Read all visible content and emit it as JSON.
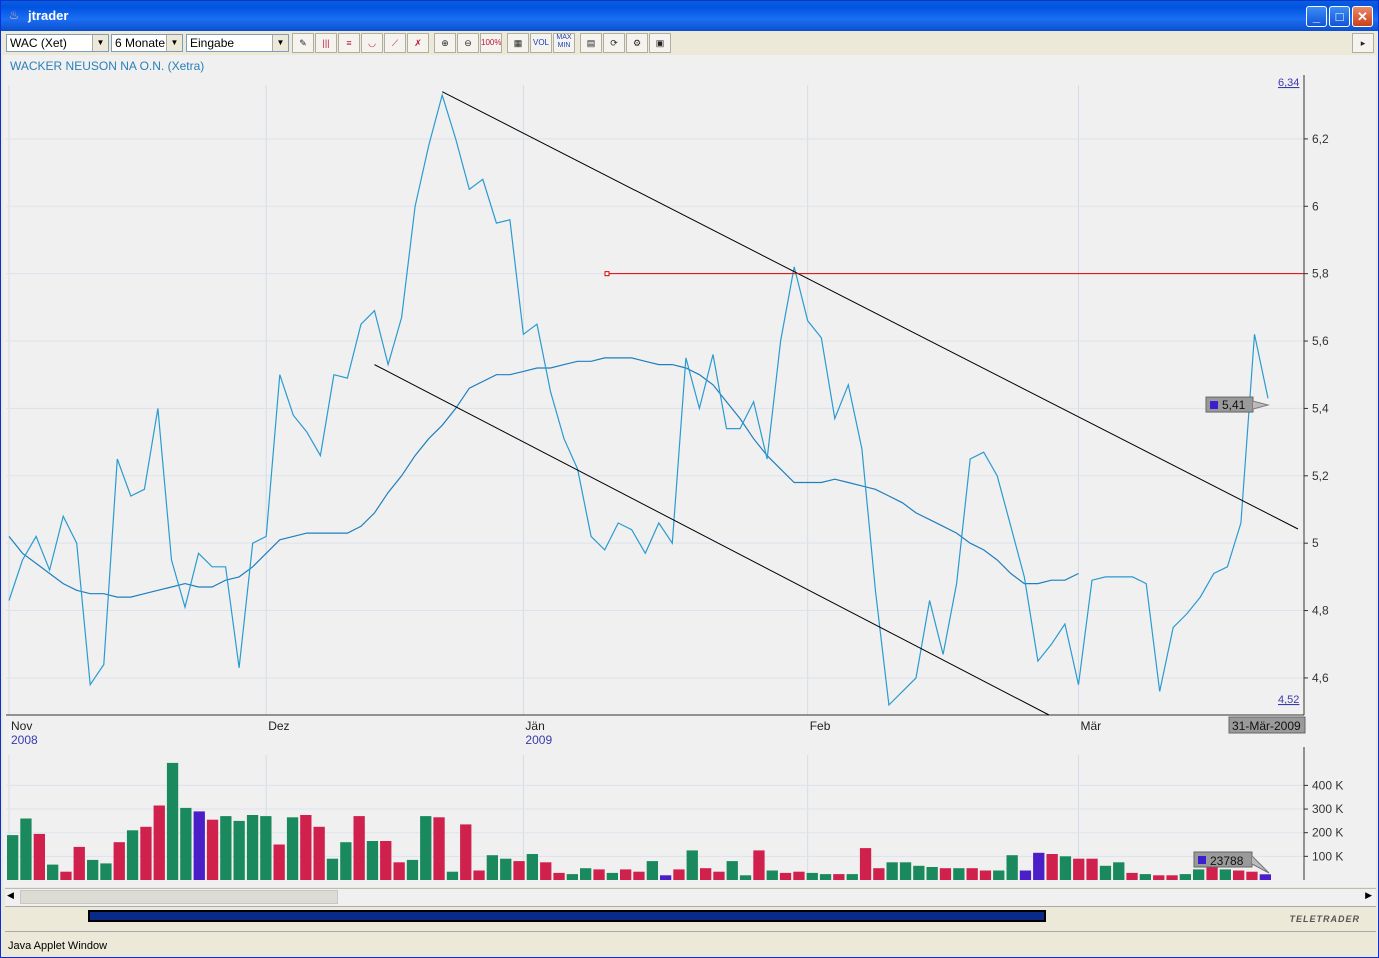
{
  "window": {
    "title": "jtrader",
    "min": "_",
    "max": "□",
    "close": "✕"
  },
  "toolbar": {
    "symbol": "WAC (Xet)",
    "period": "6 Monate",
    "mode": "Eingabe",
    "btn_vol": "VOL",
    "btn_maxmin": "MAX MIN",
    "btn_zoom100": "100%"
  },
  "stock_title": "WACKER NEUSON NA O.N. (Xetra)",
  "chart_data": [
    {
      "type": "line",
      "title": "WACKER NEUSON NA O.N. (Xetra)",
      "x_labels": [
        {
          "label": "Nov",
          "year": "2008",
          "index": 0
        },
        {
          "label": "Dez",
          "year": "",
          "index": 19
        },
        {
          "label": "Jän",
          "year": "2009",
          "index": 38
        },
        {
          "label": "Feb",
          "year": "",
          "index": 59
        },
        {
          "label": "Mär",
          "year": "",
          "index": 79
        }
      ],
      "date_marker": "31-Mär-2009",
      "yticks": [
        4.6,
        4.8,
        5,
        5.2,
        5.4,
        5.6,
        5.8,
        6,
        6.2
      ],
      "ytick_labels": [
        "4,6",
        "4,8",
        "5",
        "5,2",
        "5,4",
        "5,6",
        "5,8",
        "6",
        "6,2"
      ],
      "max_label": "6,34",
      "min_label": "4,52",
      "last_value_label": "5,41",
      "ylim": [
        4.49,
        6.36
      ],
      "series": [
        {
          "values": [
            4.83,
            4.95,
            5.02,
            4.92,
            5.08,
            5.0,
            4.58,
            4.64,
            5.25,
            5.14,
            5.16,
            5.4,
            4.95,
            4.81,
            4.97,
            4.93,
            4.93,
            4.63,
            5.0,
            5.02,
            5.5,
            5.38,
            5.33,
            5.26,
            5.5,
            5.49,
            5.65,
            5.69,
            5.53,
            5.67,
            6.0,
            6.18,
            6.33,
            6.2,
            6.05,
            6.08,
            5.95,
            5.96,
            5.62,
            5.65,
            5.45,
            5.31,
            5.22,
            5.02,
            4.98,
            5.06,
            5.04,
            4.97,
            5.06,
            5.0,
            5.55,
            5.4,
            5.56,
            5.34,
            5.34,
            5.42,
            5.25,
            5.6,
            5.82,
            5.66,
            5.61,
            5.37,
            5.47,
            5.28,
            4.86,
            4.52,
            4.56,
            4.6,
            4.83,
            4.67,
            4.88,
            5.25,
            5.27,
            5.2,
            5.05,
            4.9,
            4.65,
            4.7,
            4.76,
            4.58,
            4.89,
            4.9,
            4.9,
            4.9,
            4.88,
            4.56,
            4.75,
            4.79,
            4.84,
            4.91,
            4.93,
            5.06,
            5.62,
            5.43
          ]
        },
        {
          "values": [
            5.02,
            4.97,
            4.94,
            4.91,
            4.88,
            4.86,
            4.85,
            4.85,
            4.84,
            4.84,
            4.85,
            4.86,
            4.87,
            4.88,
            4.87,
            4.87,
            4.89,
            4.9,
            4.93,
            4.97,
            5.01,
            5.02,
            5.03,
            5.03,
            5.03,
            5.03,
            5.05,
            5.09,
            5.15,
            5.2,
            5.26,
            5.31,
            5.35,
            5.4,
            5.46,
            5.48,
            5.5,
            5.5,
            5.51,
            5.52,
            5.52,
            5.53,
            5.54,
            5.54,
            5.55,
            5.55,
            5.55,
            5.54,
            5.53,
            5.53,
            5.52,
            5.5,
            5.47,
            5.42,
            5.37,
            5.31,
            5.26,
            5.22,
            5.18,
            5.18,
            5.18,
            5.19,
            5.18,
            5.17,
            5.16,
            5.14,
            5.12,
            5.09,
            5.07,
            5.05,
            5.03,
            5.0,
            4.98,
            4.95,
            4.91,
            4.88,
            4.88,
            4.89,
            4.89,
            4.91
          ]
        }
      ],
      "annotations": {
        "horizontal_line_value": 5.8,
        "horizontal_line_color": "#e00000",
        "trend_color": "#000000"
      }
    },
    {
      "type": "bar",
      "yticks": [
        100000,
        200000,
        300000,
        400000
      ],
      "ytick_labels": [
        "100 K",
        "200 K",
        "300 K",
        "400 K"
      ],
      "ylim": [
        0,
        520000
      ],
      "last_value_label": "23788",
      "colors": {
        "up": "#1a8a5e",
        "down": "#d0204c",
        "neutral": "#4a1fc8"
      },
      "values": [
        190000,
        260000,
        195000,
        65000,
        35000,
        140000,
        85000,
        70000,
        160000,
        210000,
        225000,
        315000,
        495000,
        305000,
        290000,
        255000,
        270000,
        250000,
        275000,
        270000,
        150000,
        265000,
        275000,
        225000,
        90000,
        160000,
        270000,
        165000,
        165000,
        75000,
        85000,
        270000,
        265000,
        35000,
        235000,
        40000,
        105000,
        90000,
        80000,
        110000,
        75000,
        30000,
        25000,
        50000,
        45000,
        30000,
        45000,
        35000,
        80000,
        20000,
        45000,
        125000,
        50000,
        35000,
        80000,
        20000,
        125000,
        40000,
        30000,
        35000,
        30000,
        25000,
        25000,
        25000,
        135000,
        50000,
        75000,
        75000,
        60000,
        55000,
        50000,
        50000,
        50000,
        40000,
        40000,
        105000,
        40000,
        115000,
        110000,
        100000,
        90000,
        90000,
        60000,
        75000,
        30000,
        25000,
        20000,
        20000,
        25000,
        45000,
        60000,
        45000,
        40000,
        35000,
        24000
      ],
      "color_codes": "ggrgrrggrgrrggnrggggrgrrggrgrrggrgrrggrgrrggrgrrgnrgrrggrgrrggrgrrggggrgrrggnnrgrrggrgrrggrgrrn"
    }
  ]
}
